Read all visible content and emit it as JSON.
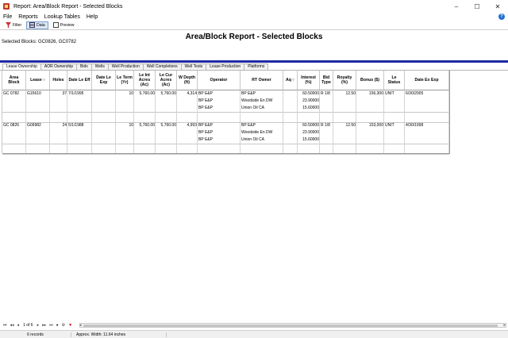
{
  "window": {
    "title": "Report: Area/Block Report - Selected Blocks"
  },
  "menu": [
    "File",
    "Reports",
    "Lookup Tables",
    "Help"
  ],
  "toolbar": {
    "filter": "Filter",
    "data": "Data",
    "preview": "Preview"
  },
  "report": {
    "title": "Area/Block Report - Selected Blocks",
    "selected_blocks": "Selected Blocks: GC0826, GC0782"
  },
  "tabs": [
    "Lease Ownership",
    "AOR Ownership",
    "Bids",
    "Wells",
    "Well Production",
    "Well Completions",
    "Well Tests",
    "Lease Production",
    "Platforms"
  ],
  "table": {
    "headers": [
      "Area Block",
      "Lease",
      "Holes",
      "Date Le Eff",
      "Date Le Exp",
      "Le Term (Yr)",
      "Le Int Acres (Ac)",
      "Le Cur Acres (Ac)",
      "W Depth (ft)",
      "Operator",
      "RT Owner",
      "Aq",
      "Interest (%)",
      "Bid Type",
      "Royalty (%)",
      "Bonus ($)",
      "Le Status",
      "Date Ex Exp"
    ],
    "rows": [
      {
        "area_block": "GC 0782",
        "lease": "G15610",
        "holes": "37",
        "date_eff": "7/1/1995",
        "date_exp": "",
        "term": "10",
        "int_acres": "5,760.00",
        "cur_acres": "5,760.00",
        "depth": "4,314",
        "operators": [
          "BP E&P",
          "BP E&P",
          "BP E&P"
        ],
        "owners": [
          "BP E&P",
          "Woodside En DW",
          "Union Oil CA"
        ],
        "aq": "",
        "interests": [
          "60.50000",
          "23.90000",
          "15.60000"
        ],
        "bid_type": "R 1/8",
        "royalty": "12.50",
        "bonus": "156,300",
        "status": "UNIT",
        "date_ex_exp": "6/30/2005"
      },
      {
        "area_block": "GC 0826",
        "lease": "G09982",
        "holes": "24",
        "date_eff": "5/1/1988",
        "date_exp": "",
        "term": "10",
        "int_acres": "5,760.00",
        "cur_acres": "5,760.00",
        "depth": "4,993",
        "operators": [
          "BP E&P",
          "BP E&P",
          "BP E&P"
        ],
        "owners": [
          "BP E&P",
          "Woodside En DW",
          "Union Oil CA"
        ],
        "aq": "",
        "interests": [
          "60.50000",
          "23.90000",
          "15.60000"
        ],
        "bid_type": "R 1/8",
        "royalty": "12.50",
        "bonus": "153,000",
        "status": "UNIT",
        "date_ex_exp": "4/30/1998"
      }
    ]
  },
  "navigator": {
    "page": "1 of 6"
  },
  "status": {
    "records": "6 records",
    "width": "Approx. Width: 11.64 inches"
  }
}
